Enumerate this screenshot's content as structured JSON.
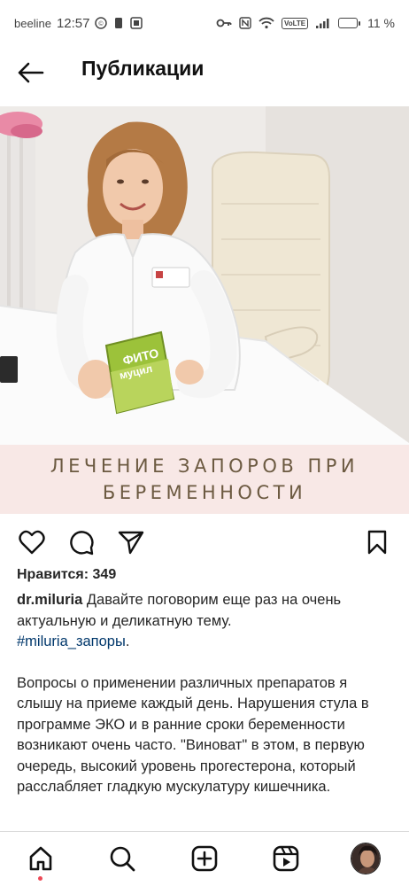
{
  "status_bar": {
    "carrier": "beeline",
    "time": "12:57",
    "battery_percent": "11 %",
    "battery_level": 0.11,
    "network_badge": "VoLTE",
    "icons": [
      "data-saver-icon",
      "sim-icon",
      "screen-icon",
      "key-icon",
      "nfc-icon",
      "wifi-icon",
      "signal-icon",
      "battery-icon"
    ]
  },
  "header": {
    "title": "Публикации",
    "back_icon": "arrow-left-icon"
  },
  "post": {
    "image": {
      "caption_line1": "ЛЕЧЕНИЕ ЗАПОРОВ ПРИ",
      "caption_line2": "БЕРЕМЕННОСТИ",
      "product_label_line1": "ФИТО",
      "product_label_line2": "муцил"
    },
    "actions": {
      "like_icon": "heart-icon",
      "comment_icon": "comment-icon",
      "share_icon": "send-icon",
      "save_icon": "bookmark-icon"
    },
    "likes": "Нравится: 349",
    "username": "dr.miluria",
    "caption_intro": " Давайте поговорим еще раз на очень актуальную и деликатную тему.",
    "hashtag": "#miluria_запоры",
    "hashtag_suffix": ".",
    "body": "Вопросы о применении различных препаратов я слышу на приеме каждый день. Нарушения стула в программе ЭКО и в ранние сроки беременности возникают очень часто. \"Виноват\" в этом, в первую очередь, высокий уровень прогестерона, который расслабляет гладкую мускулатуру кишечника."
  },
  "bottom_nav": {
    "items": [
      "home-icon",
      "search-icon",
      "create-icon",
      "reels-icon",
      "profile-avatar"
    ],
    "active": "home-icon",
    "colors": {
      "notification_dot": "#ed4956"
    }
  }
}
